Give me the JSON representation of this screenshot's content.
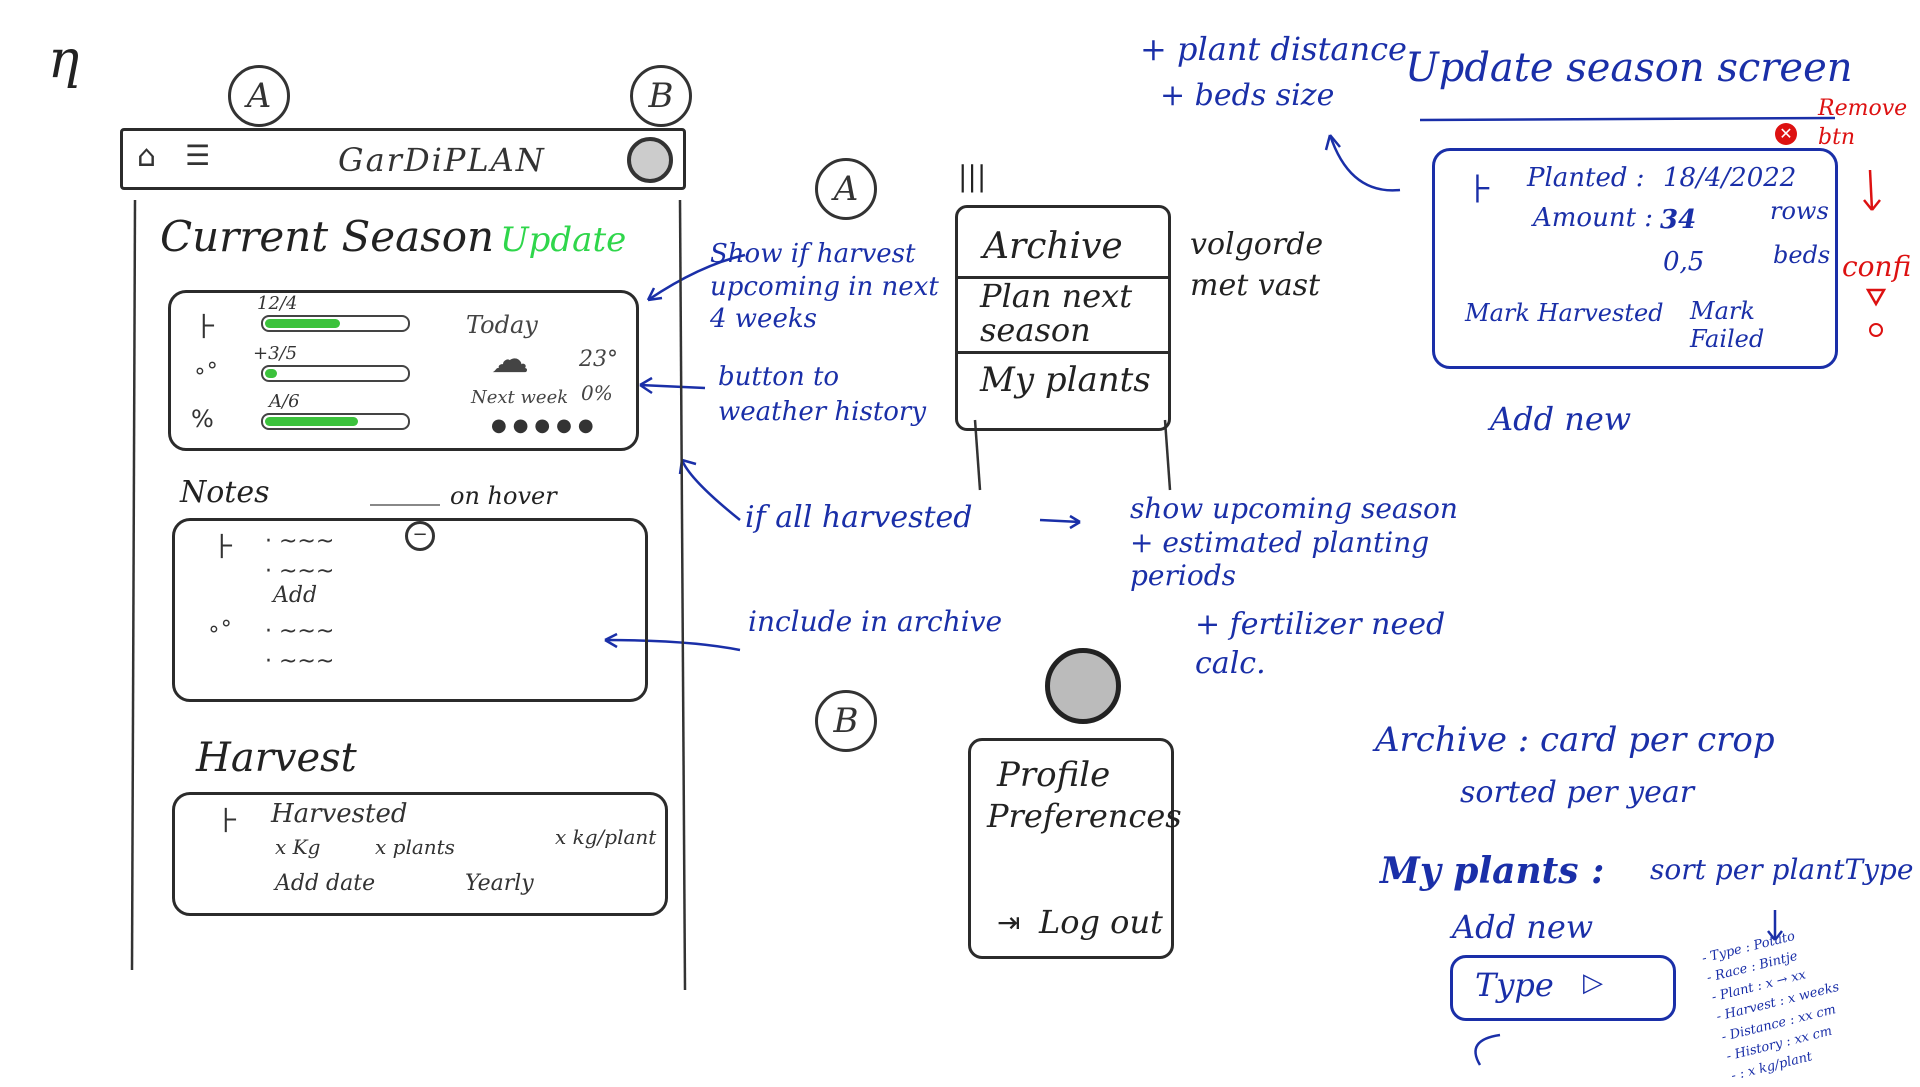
{
  "scribble": "ƞ",
  "markers": {
    "a": "A",
    "b": "B"
  },
  "app": {
    "title": "GarDiPLAN",
    "current_season": {
      "title": "Current Season",
      "update_label": "Update"
    },
    "stats": [
      {
        "label": "12/4",
        "progress": 0.52
      },
      {
        "label": "+3/5",
        "progress": 0.08
      },
      {
        "label": "A/6",
        "progress": 0.64
      }
    ],
    "weather": {
      "today": "Today",
      "temp": "23°",
      "next_week": "Next week",
      "percent": "0%"
    },
    "notes": {
      "title": "Notes",
      "add_label": "Add",
      "hover_note": "on hover"
    },
    "harvest": {
      "title": "Harvest",
      "harvested": "Harvested",
      "kg": "x Kg",
      "plants": "x plants",
      "kg_per_plant": "x kg/plant",
      "add_date": "Add date",
      "yearly": "Yearly"
    }
  },
  "menu_a": {
    "items": [
      "Archive",
      "Plan next season",
      "My plants"
    ],
    "icon_text": "|||"
  },
  "menu_b": {
    "items": [
      "Profile",
      "Preferences"
    ],
    "logout": "Log out"
  },
  "annotations": {
    "show_harvest": "Show if harvest upcoming in next 4 weeks",
    "weather_button": "button to weather history",
    "all_harvested": "if all harvested",
    "upcoming_season": "show upcoming season + estimated planting periods",
    "fertilizer": "+ fertilizer need calc.",
    "include_archive": "include in archive",
    "volgorde": "volgorde met vast",
    "plant_distance": "+ plant distance",
    "bed_size": "+ beds size",
    "remove_btn": "Remove btn",
    "confi": "confi"
  },
  "update_season": {
    "title": "Update season screen",
    "planted_label": "Planted :",
    "planted_value": "18/4/2022",
    "amount_label": "Amount :",
    "amount_value": "34",
    "rows": "rows",
    "beds_value": "0,5",
    "beds": "beds",
    "mark_harvested": "Mark Harvested",
    "mark_failed": "Mark Failed",
    "add_new": "Add new"
  },
  "archive_note": {
    "line1": "Archive : card per crop",
    "line2": "sorted per year"
  },
  "my_plants": {
    "title": "My plants :",
    "sort": "sort per plantType",
    "add_new": "Add new",
    "type_label": "Type",
    "fields": [
      "- Type : Potato",
      "- Race : Bintje",
      "- Plant : x → xx",
      "- Harvest : x weeks",
      "- Distance : xx cm",
      "- History : xx cm",
      "- : x kg/plant"
    ]
  }
}
